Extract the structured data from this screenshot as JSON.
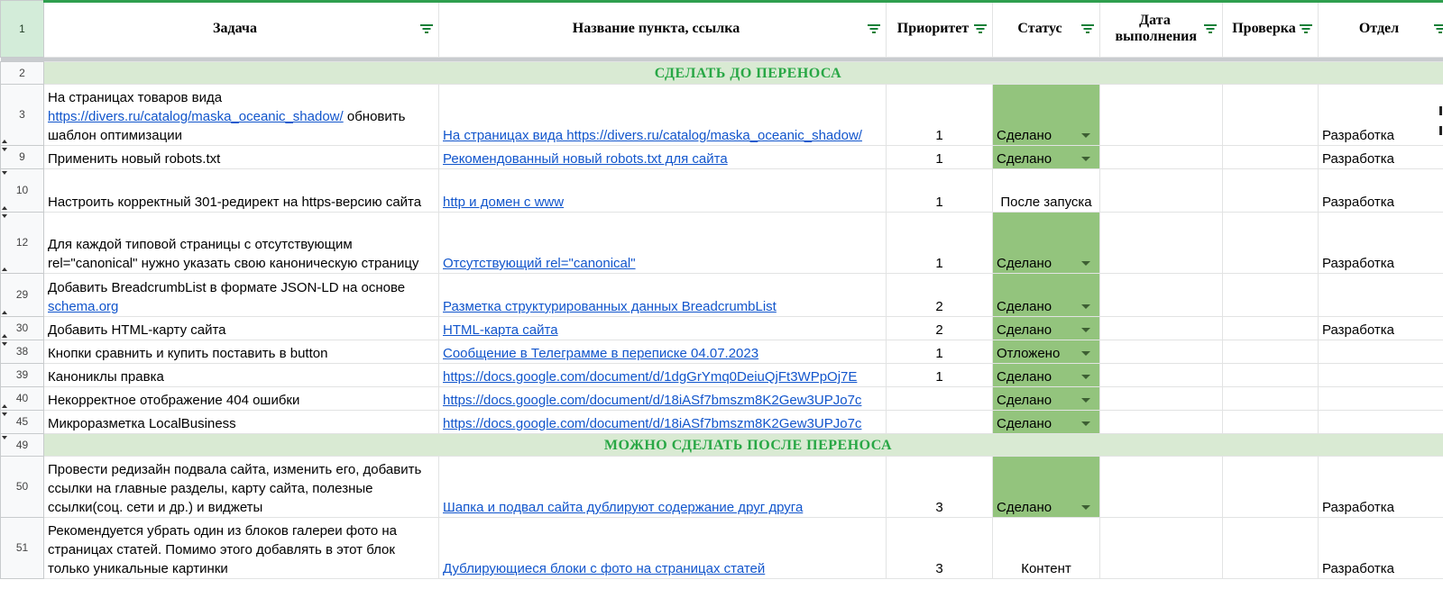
{
  "header": {
    "row_num": "1",
    "columns": [
      "Задача",
      "Название пункта, ссылка",
      "Приоритет",
      "Статус",
      "Дата выполнения",
      "Проверка",
      "Отдел"
    ]
  },
  "section_before": {
    "row_num": "2",
    "title": "СДЕЛАТЬ ДО ПЕРЕНОСА"
  },
  "section_after": {
    "row_num": "49",
    "title": "МОЖНО СДЕЛАТЬ ПОСЛЕ ПЕРЕНОСА"
  },
  "rows": [
    {
      "num": "3",
      "task_pre": "На страницах товаров вида ",
      "task_link": "https://divers.ru/catalog/maska_oceanic_shadow/",
      "task_post": " обновить шаблон оптимизации",
      "ref": "На страницах вида https://divers.ru/catalog/maska_oceanic_shadow/",
      "priority": "1",
      "status": "Сделано",
      "dept": "Разработка"
    },
    {
      "num": "9",
      "task_pre": "Применить новый robots.txt",
      "task_link": "",
      "task_post": "",
      "ref": "Рекомендованный новый robots.txt для сайта",
      "priority": "1",
      "status": "Сделано",
      "dept": "Разработка"
    },
    {
      "num": "10",
      "task_pre": "Настроить корректный 301-редирект на https-версию сайта",
      "task_link": "",
      "task_post": "",
      "ref": "http и домен с www",
      "priority": "1",
      "status": "После запуска",
      "dept": "Разработка"
    },
    {
      "num": "12",
      "task_pre": "Для каждой типовой страницы с отсутствующим rel=\"canonical\" нужно указать свою каноническую страницу",
      "task_link": "",
      "task_post": "",
      "ref": "Отсутствующий rel=\"canonical\"",
      "priority": "1",
      "status": "Сделано",
      "dept": "Разработка"
    },
    {
      "num": "29",
      "task_pre": "Добавить BreadcrumbList в формате JSON-LD на основе ",
      "task_link": "schema.org",
      "task_post": "",
      "ref": "Разметка структурированных данных BreadcrumbList",
      "priority": "2",
      "status": "Сделано",
      "dept": ""
    },
    {
      "num": "30",
      "task_pre": "Добавить HTML-карту сайта",
      "task_link": "",
      "task_post": "",
      "ref": "HTML-карта сайта",
      "priority": "2",
      "status": "Сделано",
      "dept": "Разработка"
    },
    {
      "num": "38",
      "task_pre": "Кнопки сравнить и купить поставить в button",
      "task_link": "",
      "task_post": "",
      "ref": "Сообщение в Телеграмме в переписке 04.07.2023",
      "priority": "1",
      "status": "Отложено",
      "dept": ""
    },
    {
      "num": "39",
      "task_pre": "Канониклы правка",
      "task_link": "",
      "task_post": "",
      "ref": "https://docs.google.com/document/d/1dgGrYmq0DeiuQjFt3WPpOj7E",
      "priority": "1",
      "status": "Сделано",
      "dept": ""
    },
    {
      "num": "40",
      "task_pre": "Некорректное отображение 404 ошибки",
      "task_link": "",
      "task_post": "",
      "ref": "https://docs.google.com/document/d/18iASf7bmszm8K2Gew3UPJo7c",
      "priority": "",
      "status": "Сделано",
      "dept": ""
    },
    {
      "num": "45",
      "task_pre": "Микроразметка LocalBusiness",
      "task_link": "",
      "task_post": "",
      "ref": "https://docs.google.com/document/d/18iASf7bmszm8K2Gew3UPJo7c",
      "priority": "",
      "status": "Сделано",
      "dept": ""
    }
  ],
  "rows_after": [
    {
      "num": "50",
      "task_pre": "Провести редизайн подвала сайта, изменить его, добавить ссылки на главные разделы, карту сайта, полезные ссылки(соц. сети и др.) и виджеты",
      "task_link": "",
      "task_post": "",
      "ref": "Шапка и подвал сайта дублируют содержание друг друга",
      "priority": "3",
      "status": "Сделано",
      "dept": "Разработка"
    },
    {
      "num": "51",
      "task_pre": "Рекомендуется убрать один из блоков галереи фото на страницах статей. Помимо этого добавлять в этот блок только уникальные картинки",
      "task_link": "",
      "task_post": "",
      "ref": "Дублирующиеся блоки с фото на страницах статей",
      "priority": "3",
      "status": "Контент",
      "dept": "Разработка"
    }
  ],
  "colors": {
    "status_done": "#93c47d",
    "section_band": "#d9ead3",
    "section_text": "#28a745",
    "link": "#1155cc",
    "accent": "#188038"
  },
  "icons": {
    "filter": "filter-icon",
    "dropdown": "dropdown-caret-icon"
  }
}
